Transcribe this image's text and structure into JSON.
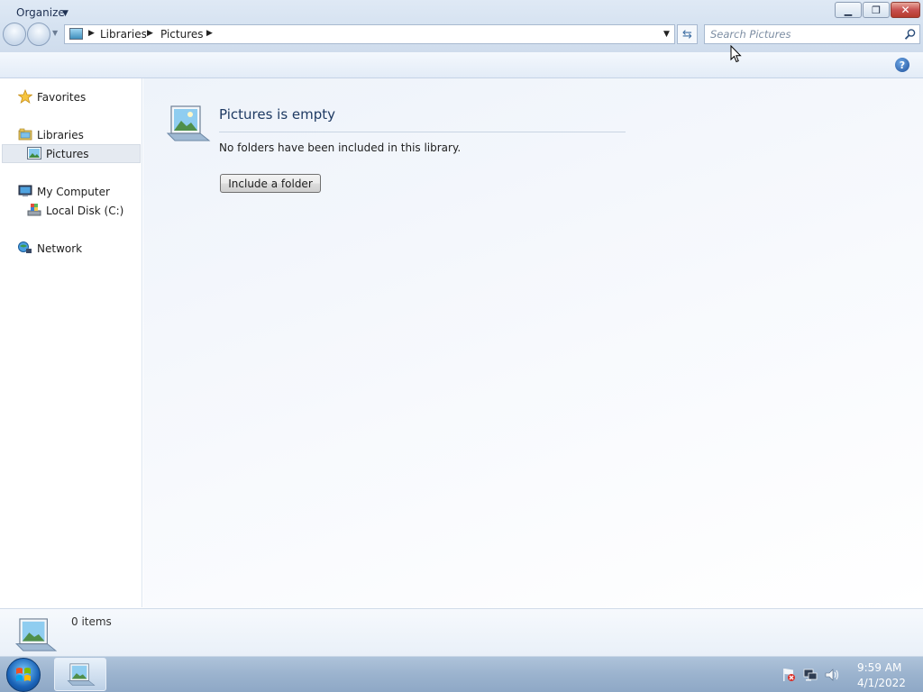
{
  "window": {
    "caption_buttons": {
      "minimize": "▁",
      "maximize": "❐",
      "close": "✕"
    }
  },
  "address_bar": {
    "breadcrumbs": [
      "Libraries",
      "Pictures"
    ],
    "icons": {
      "location": "pictures-library-icon",
      "refresh": "refresh-icon",
      "dropdown": "chevron-down-icon"
    }
  },
  "search": {
    "placeholder": "Search Pictures",
    "value": ""
  },
  "toolbar": {
    "organize_label": "Organize",
    "help_icon": "?"
  },
  "nav_pane": {
    "favorites": "Favorites",
    "libraries": "Libraries",
    "pictures": "Pictures",
    "computer": "My Computer",
    "local_disk": "Local Disk (C:)",
    "network": "Network",
    "selected": "Pictures"
  },
  "content": {
    "empty_title": "Pictures is empty",
    "empty_message": "No folders have been included in this library.",
    "include_button": "Include a folder"
  },
  "details": {
    "item_count": "0 items"
  },
  "taskbar": {
    "time": "9:59 AM",
    "date": "4/1/2022"
  }
}
